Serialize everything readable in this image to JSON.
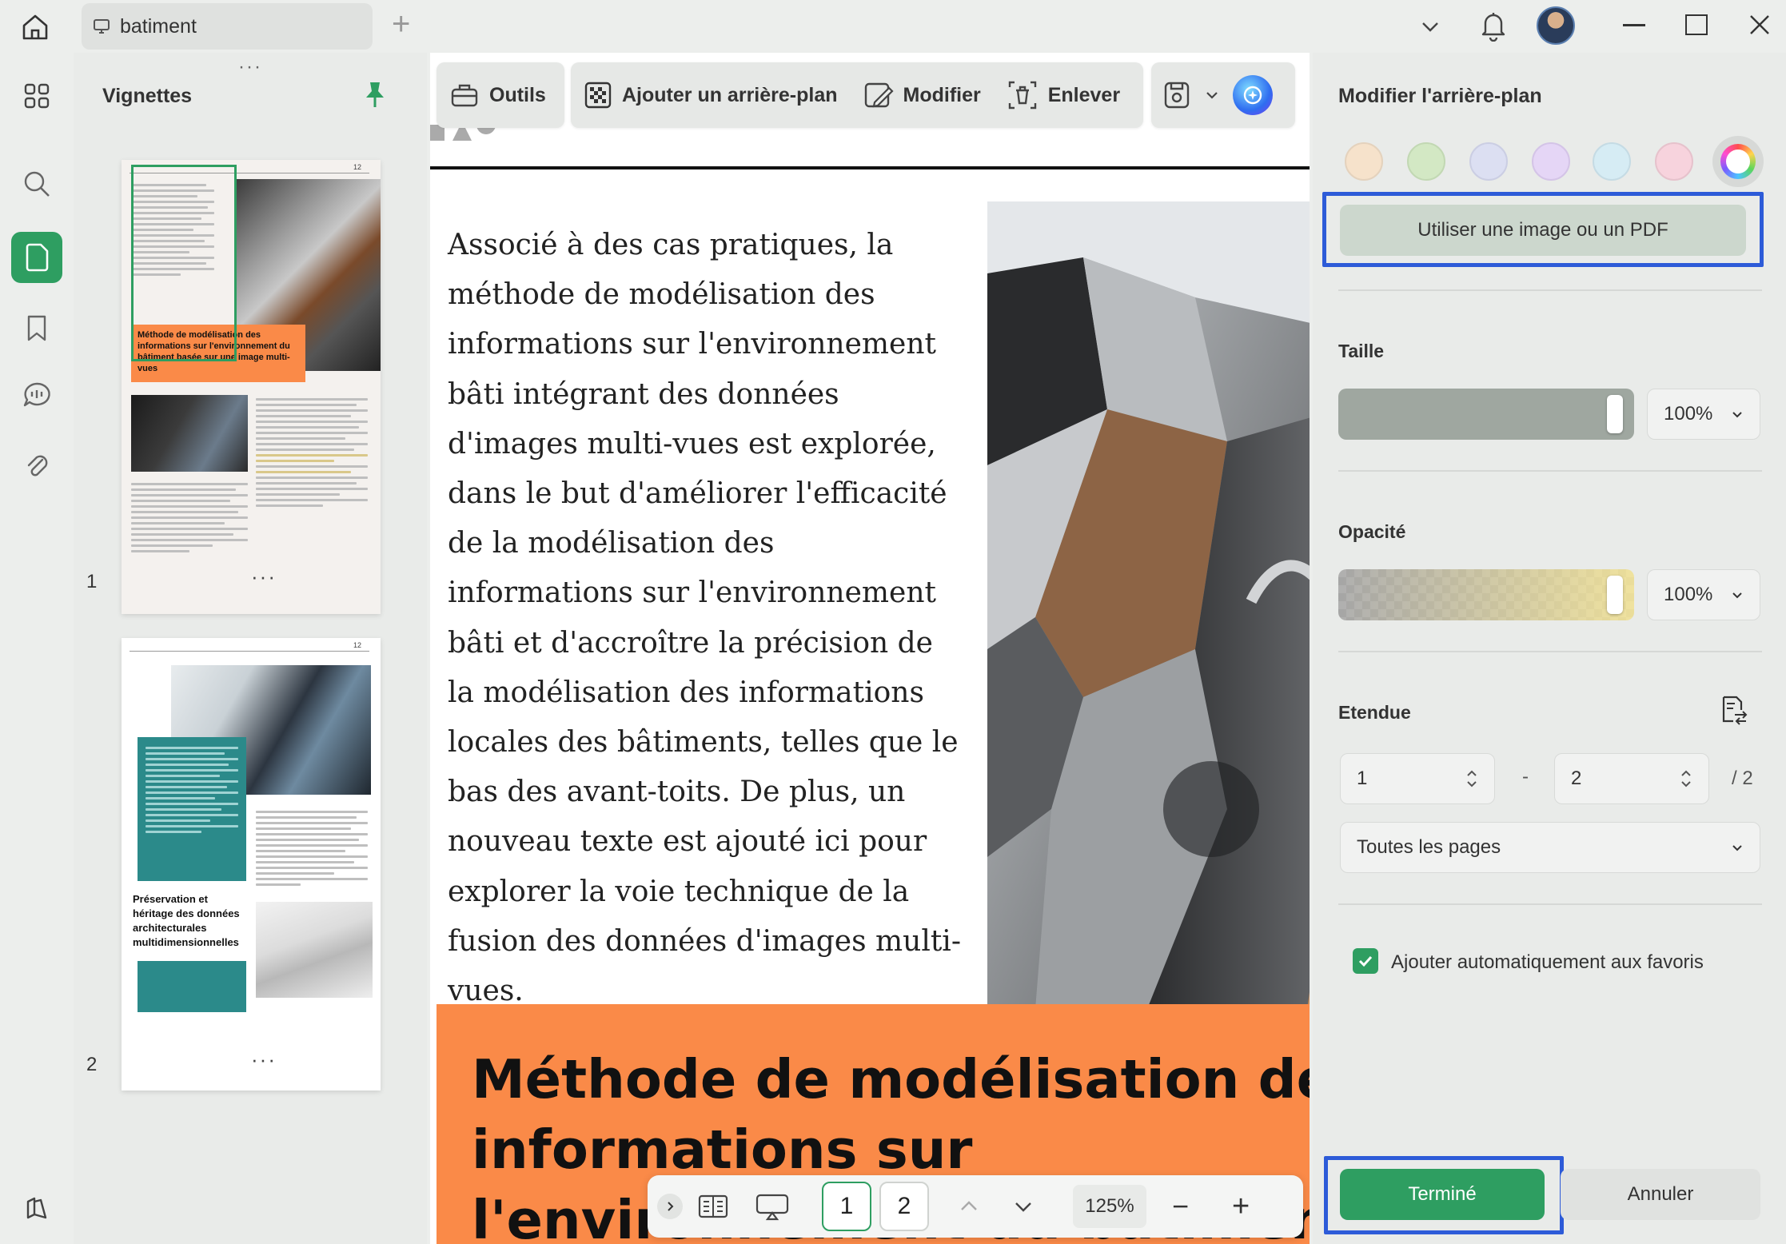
{
  "window": {
    "tab_title": "batiment",
    "new_tab": "+"
  },
  "thumbnails": {
    "title": "Vignettes",
    "pages": [
      {
        "number": "1",
        "more": "···"
      },
      {
        "number": "2",
        "more": "···"
      }
    ],
    "page1_heading": "Méthode de modélisation des informations sur l'environnement du bâtiment basée sur une image multi-vues",
    "page2_heading": "Préservation et héritage des données architecturales multidimensionnelles",
    "page_header_num": "12"
  },
  "toolbar": {
    "tools_label": "Outils",
    "add_background_label": "Ajouter un arrière-plan",
    "edit_label": "Modifier",
    "remove_label": "Enlever"
  },
  "document": {
    "paragraph": "Associé à des cas pratiques, la méthode de modélisation des informations sur l'environnement bâti intégrant des données d'images multi-vues est explorée, dans le but d'améliorer l'efficacité de la modélisation des informations sur l'environnement bâti et d'accroître la précision de la modélisation des informations locales des bâtiments, telles que le bas des avant-toits. De plus, un nouveau texte est ajouté ici pour explorer la voie technique de la fusion des données d'images multi-vues.",
    "heading_line1": "Méthode de modélisation des",
    "heading_line2": "informations sur",
    "heading_line3": "l'environnement du bâtiment"
  },
  "pager": {
    "page1": "1",
    "page2": "2",
    "zoom": "125%",
    "zoom_out": "−",
    "zoom_in": "+"
  },
  "panel": {
    "title": "Modifier l'arrière-plan",
    "swatch_colors": [
      "#f6e2cb",
      "#d3e8c4",
      "#dcdff2",
      "#e5d6f6",
      "#d6ecf4",
      "#f7d3dd"
    ],
    "use_image_button": "Utiliser une image ou un PDF",
    "size_label": "Taille",
    "size_value": "100%",
    "opacity_label": "Opacité",
    "opacity_value": "100%",
    "range_label": "Etendue",
    "range_from": "1",
    "range_to": "2",
    "range_total": "/ 2",
    "range_dash": "-",
    "pages_select": "Toutes les pages",
    "auto_favorites_label": "Ajouter automatiquement aux favoris",
    "auto_favorites_checked": true,
    "done_button": "Terminé",
    "cancel_button": "Annuler"
  },
  "colors": {
    "accent": "#2e9e61",
    "orange": "#fa8a48",
    "focus": "#2d5bd8"
  }
}
